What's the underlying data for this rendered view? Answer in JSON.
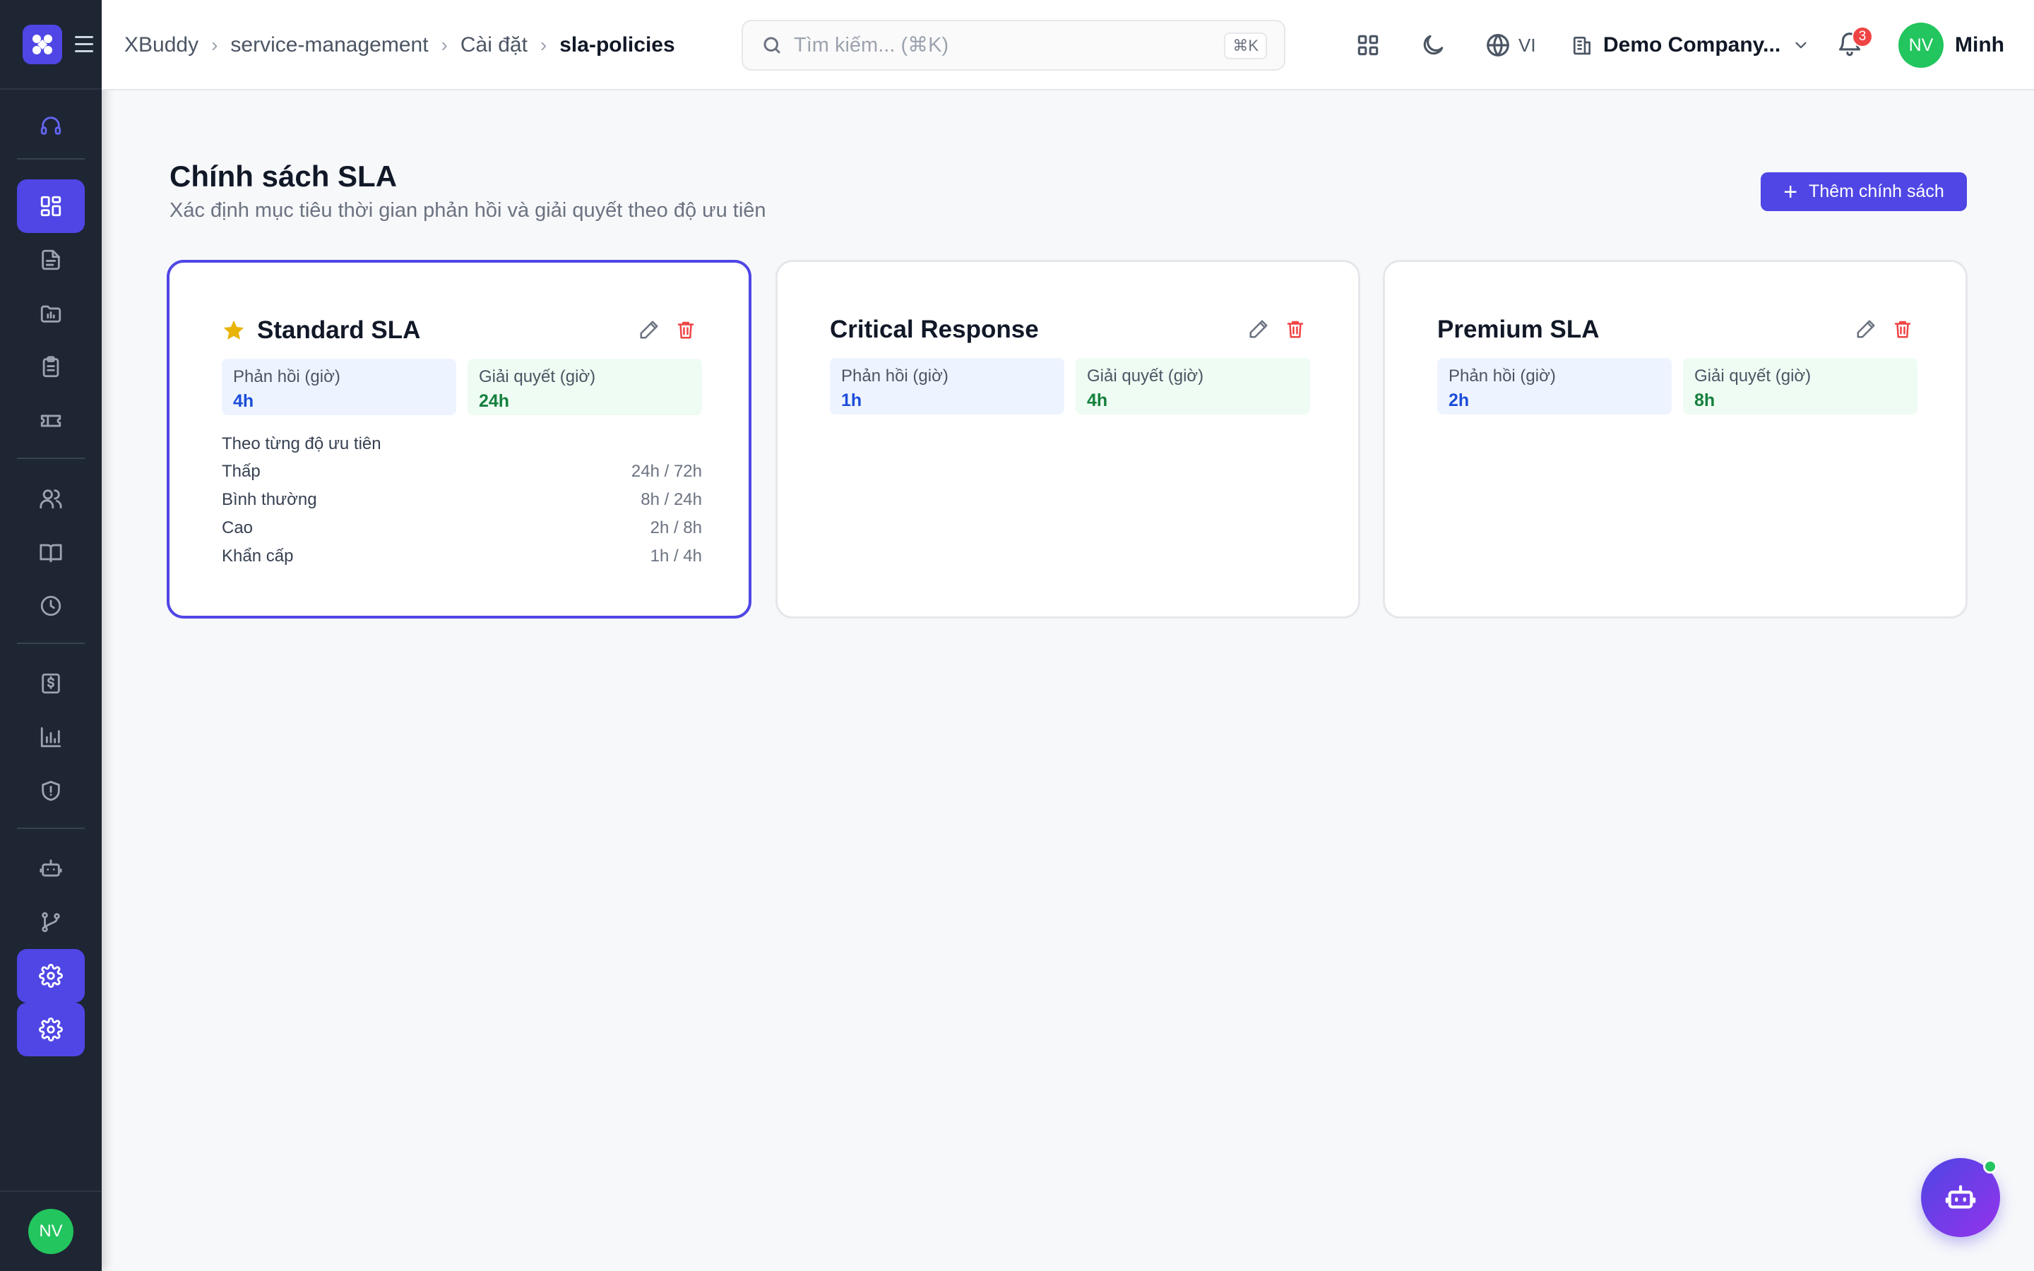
{
  "breadcrumb": [
    "XBuddy",
    "service-management",
    "Cài đặt",
    "sla-policies"
  ],
  "search": {
    "placeholder": "Tìm kiếm... (⌘K)",
    "shortcut": "⌘K"
  },
  "header": {
    "language": "VI",
    "company": "Demo Company...",
    "notification_count": "3",
    "user_initials": "NV",
    "user_name": "Minh"
  },
  "sidebar": {
    "items": [
      "headset-icon",
      "dashboard-icon",
      "document-icon",
      "folder-icon",
      "clipboard-icon",
      "ticket-icon",
      "users-icon",
      "book-icon",
      "clock-icon",
      "invoice-icon",
      "chart-icon",
      "shield-icon",
      "bot-icon",
      "branch-icon",
      "settings-icon",
      "settings-icon"
    ],
    "user_initials": "NV"
  },
  "page": {
    "title": "Chính sách SLA",
    "subtitle": "Xác định mục tiêu thời gian phản hồi và giải quyết theo độ ưu tiên",
    "add_button": "Thêm chính sách"
  },
  "policies": [
    {
      "name": "Standard SLA",
      "default": true,
      "response_label": "Phản hồi (giờ)",
      "response": "4h",
      "resolve_label": "Giải quyết (giờ)",
      "resolve": "24h",
      "priority_heading": "Theo từng độ ưu tiên",
      "priorities": [
        {
          "name": "Thấp",
          "value": "24h / 72h"
        },
        {
          "name": "Bình thường",
          "value": "8h / 24h"
        },
        {
          "name": "Cao",
          "value": "2h / 8h"
        },
        {
          "name": "Khẩn cấp",
          "value": "1h / 4h"
        }
      ]
    },
    {
      "name": "Critical Response",
      "response_label": "Phản hồi (giờ)",
      "response": "1h",
      "resolve_label": "Giải quyết (giờ)",
      "resolve": "4h"
    },
    {
      "name": "Premium SLA",
      "response_label": "Phản hồi (giờ)",
      "response": "2h",
      "resolve_label": "Giải quyết (giờ)",
      "resolve": "8h"
    }
  ],
  "colors": {
    "accent": "#4f46e5",
    "sidebar": "#1e2533",
    "success": "#22c55e",
    "danger": "#ef4444"
  }
}
